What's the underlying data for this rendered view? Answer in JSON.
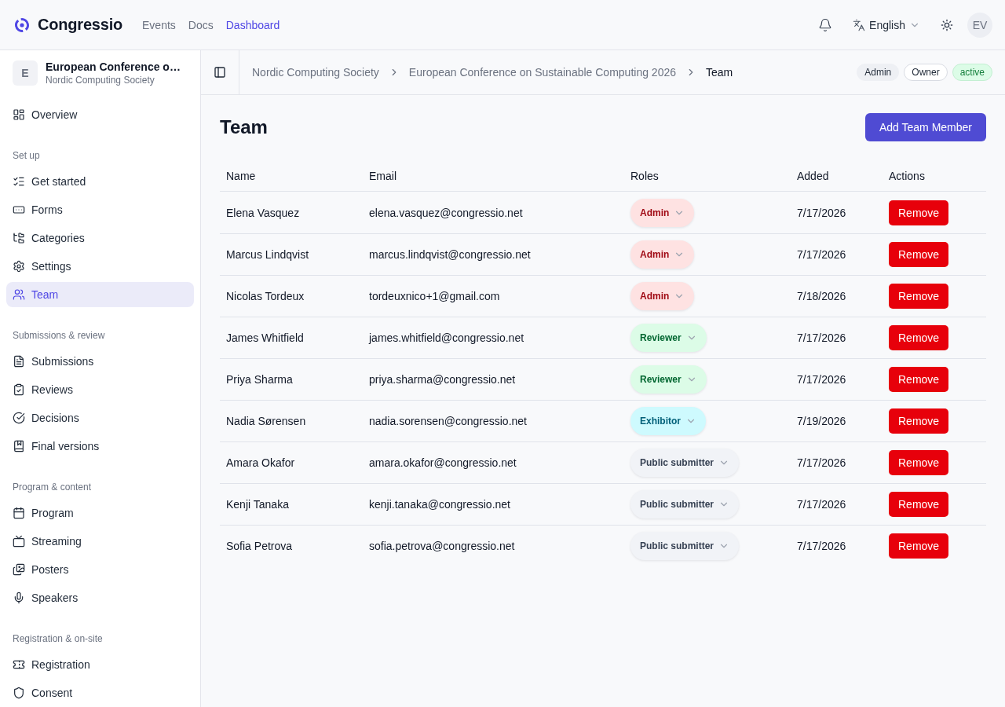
{
  "header": {
    "brand": "Congressio",
    "nav": [
      {
        "label": "Events",
        "selected": false
      },
      {
        "label": "Docs",
        "selected": false
      },
      {
        "label": "Dashboard",
        "selected": true
      }
    ],
    "language": "English",
    "user_initials": "EV"
  },
  "sidebar": {
    "event": {
      "initial": "E",
      "title": "European Conference o…",
      "organization": "Nordic Computing Society"
    },
    "groups": [
      {
        "items": [
          {
            "label": "Overview",
            "selected": false
          }
        ]
      },
      {
        "title": "Set up",
        "items": [
          {
            "label": "Get started",
            "selected": false
          },
          {
            "label": "Forms",
            "selected": false
          },
          {
            "label": "Categories",
            "selected": false
          },
          {
            "label": "Settings",
            "selected": false
          },
          {
            "label": "Team",
            "selected": true
          }
        ]
      },
      {
        "title": "Submissions & review",
        "items": [
          {
            "label": "Submissions",
            "selected": false
          },
          {
            "label": "Reviews",
            "selected": false
          },
          {
            "label": "Decisions",
            "selected": false
          },
          {
            "label": "Final versions",
            "selected": false
          }
        ]
      },
      {
        "title": "Program & content",
        "items": [
          {
            "label": "Program",
            "selected": false
          },
          {
            "label": "Streaming",
            "selected": false
          },
          {
            "label": "Posters",
            "selected": false
          },
          {
            "label": "Speakers",
            "selected": false
          }
        ]
      },
      {
        "title": "Registration & on-site",
        "items": [
          {
            "label": "Registration",
            "selected": false
          },
          {
            "label": "Consent",
            "selected": false
          }
        ]
      }
    ]
  },
  "breadcrumb": {
    "items": [
      {
        "label": "Nordic Computing Society",
        "current": false
      },
      {
        "label": "European Conference on Sustainable Computing 2026",
        "current": false
      },
      {
        "label": "Team",
        "current": true
      }
    ],
    "badges": [
      {
        "label": "Admin",
        "kind": "muted"
      },
      {
        "label": "Owner",
        "kind": "outline"
      },
      {
        "label": "active",
        "kind": "success"
      }
    ]
  },
  "page": {
    "title": "Team",
    "primary_button": "Add Team Member"
  },
  "table": {
    "columns": [
      "Name",
      "Email",
      "Roles",
      "Added",
      "Actions"
    ],
    "rows": [
      {
        "name": "Elena Vasquez",
        "email": "elena.vasquez@congressio.net",
        "role": {
          "label": "Admin",
          "kind": "admin"
        },
        "added": "7/17/2026",
        "action": "Remove"
      },
      {
        "name": "Marcus Lindqvist",
        "email": "marcus.lindqvist@congressio.net",
        "role": {
          "label": "Admin",
          "kind": "admin"
        },
        "added": "7/17/2026",
        "action": "Remove"
      },
      {
        "name": "Nicolas Tordeux",
        "email": "tordeuxnico+1@gmail.com",
        "role": {
          "label": "Admin",
          "kind": "admin"
        },
        "added": "7/18/2026",
        "action": "Remove"
      },
      {
        "name": "James Whitfield",
        "email": "james.whitfield@congressio.net",
        "role": {
          "label": "Reviewer",
          "kind": "reviewer"
        },
        "added": "7/17/2026",
        "action": "Remove"
      },
      {
        "name": "Priya Sharma",
        "email": "priya.sharma@congressio.net",
        "role": {
          "label": "Reviewer",
          "kind": "reviewer"
        },
        "added": "7/17/2026",
        "action": "Remove"
      },
      {
        "name": "Nadia Sørensen",
        "email": "nadia.sorensen@congressio.net",
        "role": {
          "label": "Exhibitor",
          "kind": "exhibitor"
        },
        "added": "7/19/2026",
        "action": "Remove"
      },
      {
        "name": "Amara Okafor",
        "email": "amara.okafor@congressio.net",
        "role": {
          "label": "Public submitter",
          "kind": "submitter"
        },
        "added": "7/17/2026",
        "action": "Remove"
      },
      {
        "name": "Kenji Tanaka",
        "email": "kenji.tanaka@congressio.net",
        "role": {
          "label": "Public submitter",
          "kind": "submitter"
        },
        "added": "7/17/2026",
        "action": "Remove"
      },
      {
        "name": "Sofia Petrova",
        "email": "sofia.petrova@congressio.net",
        "role": {
          "label": "Public submitter",
          "kind": "submitter"
        },
        "added": "7/17/2026",
        "action": "Remove"
      }
    ]
  }
}
